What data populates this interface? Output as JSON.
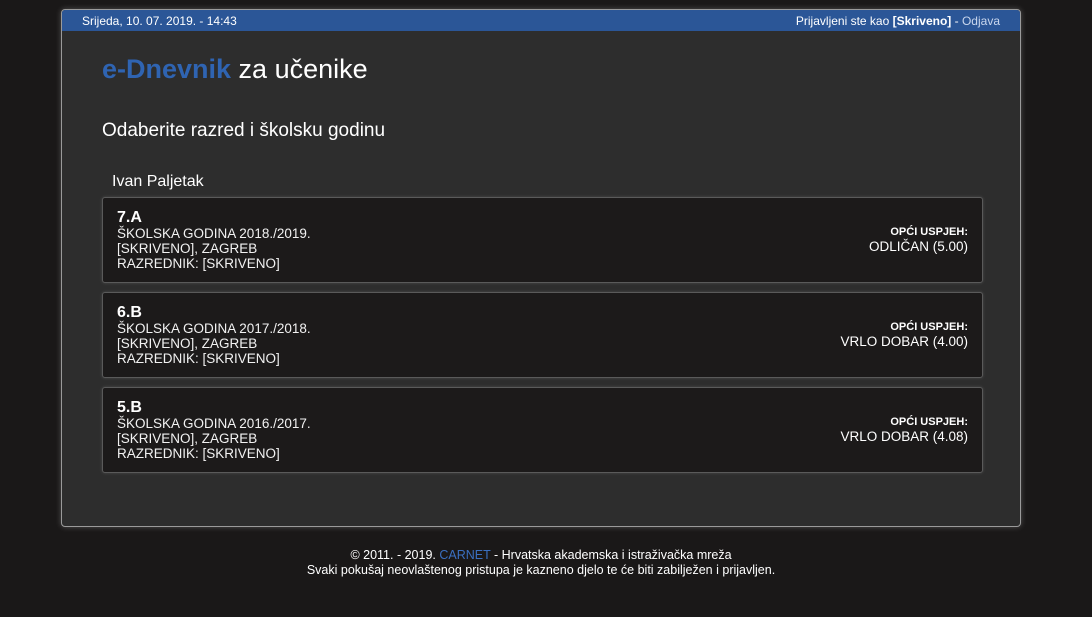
{
  "topbar": {
    "datetime": "Srijeda, 10. 07. 2019. - 14:43",
    "logged_in_prefix": "Prijavljeni ste kao ",
    "username": "[Skriveno]",
    "separator": " - ",
    "logout": "Odjava"
  },
  "brand": {
    "accent": "e-Dnevnik",
    "rest": " za učenike"
  },
  "subtitle": "Odaberite razred i školsku godinu",
  "student": "Ivan Paljetak",
  "classes": [
    {
      "name": "7.A",
      "year": "ŠKOLSKA GODINA 2018./2019.",
      "school": "[SKRIVENO], ZAGREB",
      "teacher": "RAZREDNIK: [SKRIVENO]",
      "grade_label": "OPĆI USPJEH:",
      "grade_value": "ODLIČAN (5.00)"
    },
    {
      "name": "6.B",
      "year": "ŠKOLSKA GODINA 2017./2018.",
      "school": "[SKRIVENO], ZAGREB",
      "teacher": "RAZREDNIK: [SKRIVENO]",
      "grade_label": "OPĆI USPJEH:",
      "grade_value": "VRLO DOBAR (4.00)"
    },
    {
      "name": "5.B",
      "year": "ŠKOLSKA GODINA 2016./2017.",
      "school": "[SKRIVENO], ZAGREB",
      "teacher": "RAZREDNIK: [SKRIVENO]",
      "grade_label": "OPĆI USPJEH:",
      "grade_value": "VRLO DOBAR (4.08)"
    }
  ],
  "footer": {
    "copyright_prefix": "© 2011. - 2019. ",
    "carnet": "CARNET",
    "copyright_suffix": " - Hrvatska akademska i istraživačka mreža",
    "warning": "Svaki pokušaj neovlaštenog pristupa je kazneno djelo te će biti zabilježen i prijavljen."
  },
  "colors": {
    "accent": "#2f64b2",
    "topbar": "#2b5697",
    "background": "#1a1818",
    "panel": "#2d2d2d"
  }
}
